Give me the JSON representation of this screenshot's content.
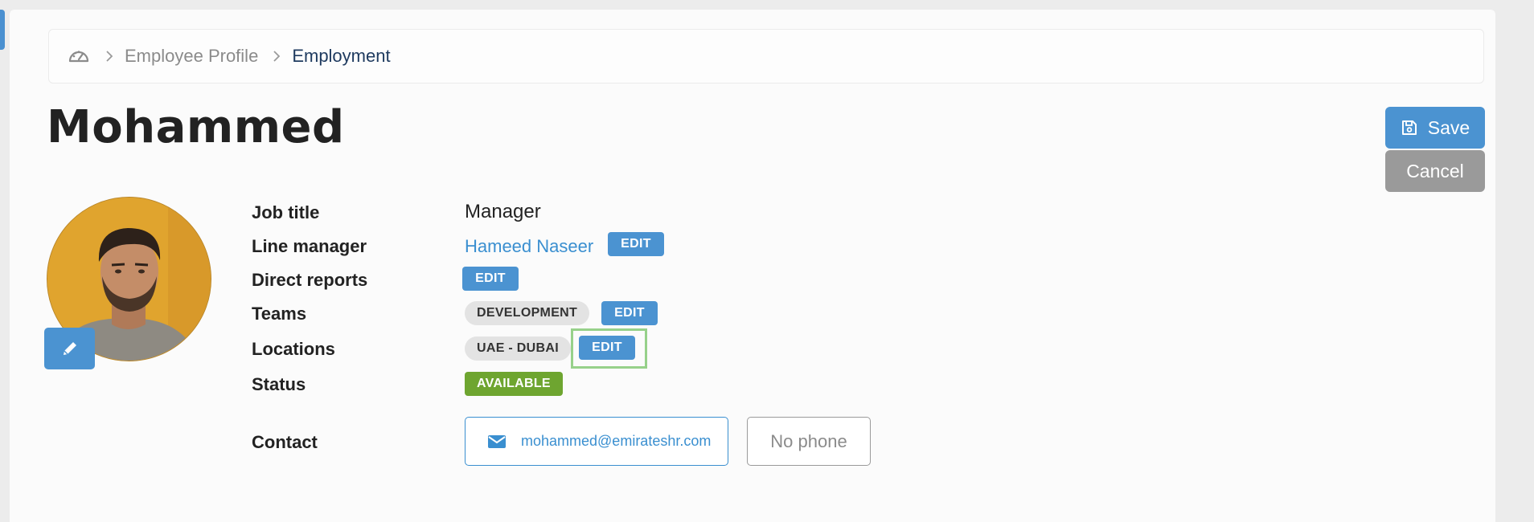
{
  "breadcrumb": {
    "items": [
      "Employee Profile"
    ],
    "current": "Employment"
  },
  "employee": {
    "name": "Mohammed"
  },
  "actions": {
    "save_label": "Save",
    "cancel_label": "Cancel"
  },
  "fields": {
    "job_title": {
      "label": "Job title",
      "value": "Manager"
    },
    "line_manager": {
      "label": "Line manager",
      "value": "Hameed Naseer",
      "edit_label": "EDIT"
    },
    "direct_reports": {
      "label": "Direct reports",
      "edit_label": "EDIT"
    },
    "teams": {
      "label": "Teams",
      "tags": [
        "DEVELOPMENT"
      ],
      "edit_label": "EDIT"
    },
    "locations": {
      "label": "Locations",
      "tags": [
        "UAE - DUBAI"
      ],
      "edit_label": "EDIT"
    },
    "status": {
      "label": "Status",
      "value": "AVAILABLE"
    },
    "contact": {
      "label": "Contact",
      "email": "mohammed@emirateshr.com",
      "phone": "No phone"
    }
  },
  "colors": {
    "primary": "#4b93d1",
    "secondary": "#9a9a9a",
    "status_available": "#6ea530",
    "link": "#3a8fd0",
    "focus": "#97d18a"
  },
  "icons": {
    "home": "dashboard-gauge-icon",
    "save": "floppy-disk-icon",
    "edit_photo": "pencil-icon",
    "email": "envelope-icon",
    "separator": "chevron-right-icon"
  }
}
